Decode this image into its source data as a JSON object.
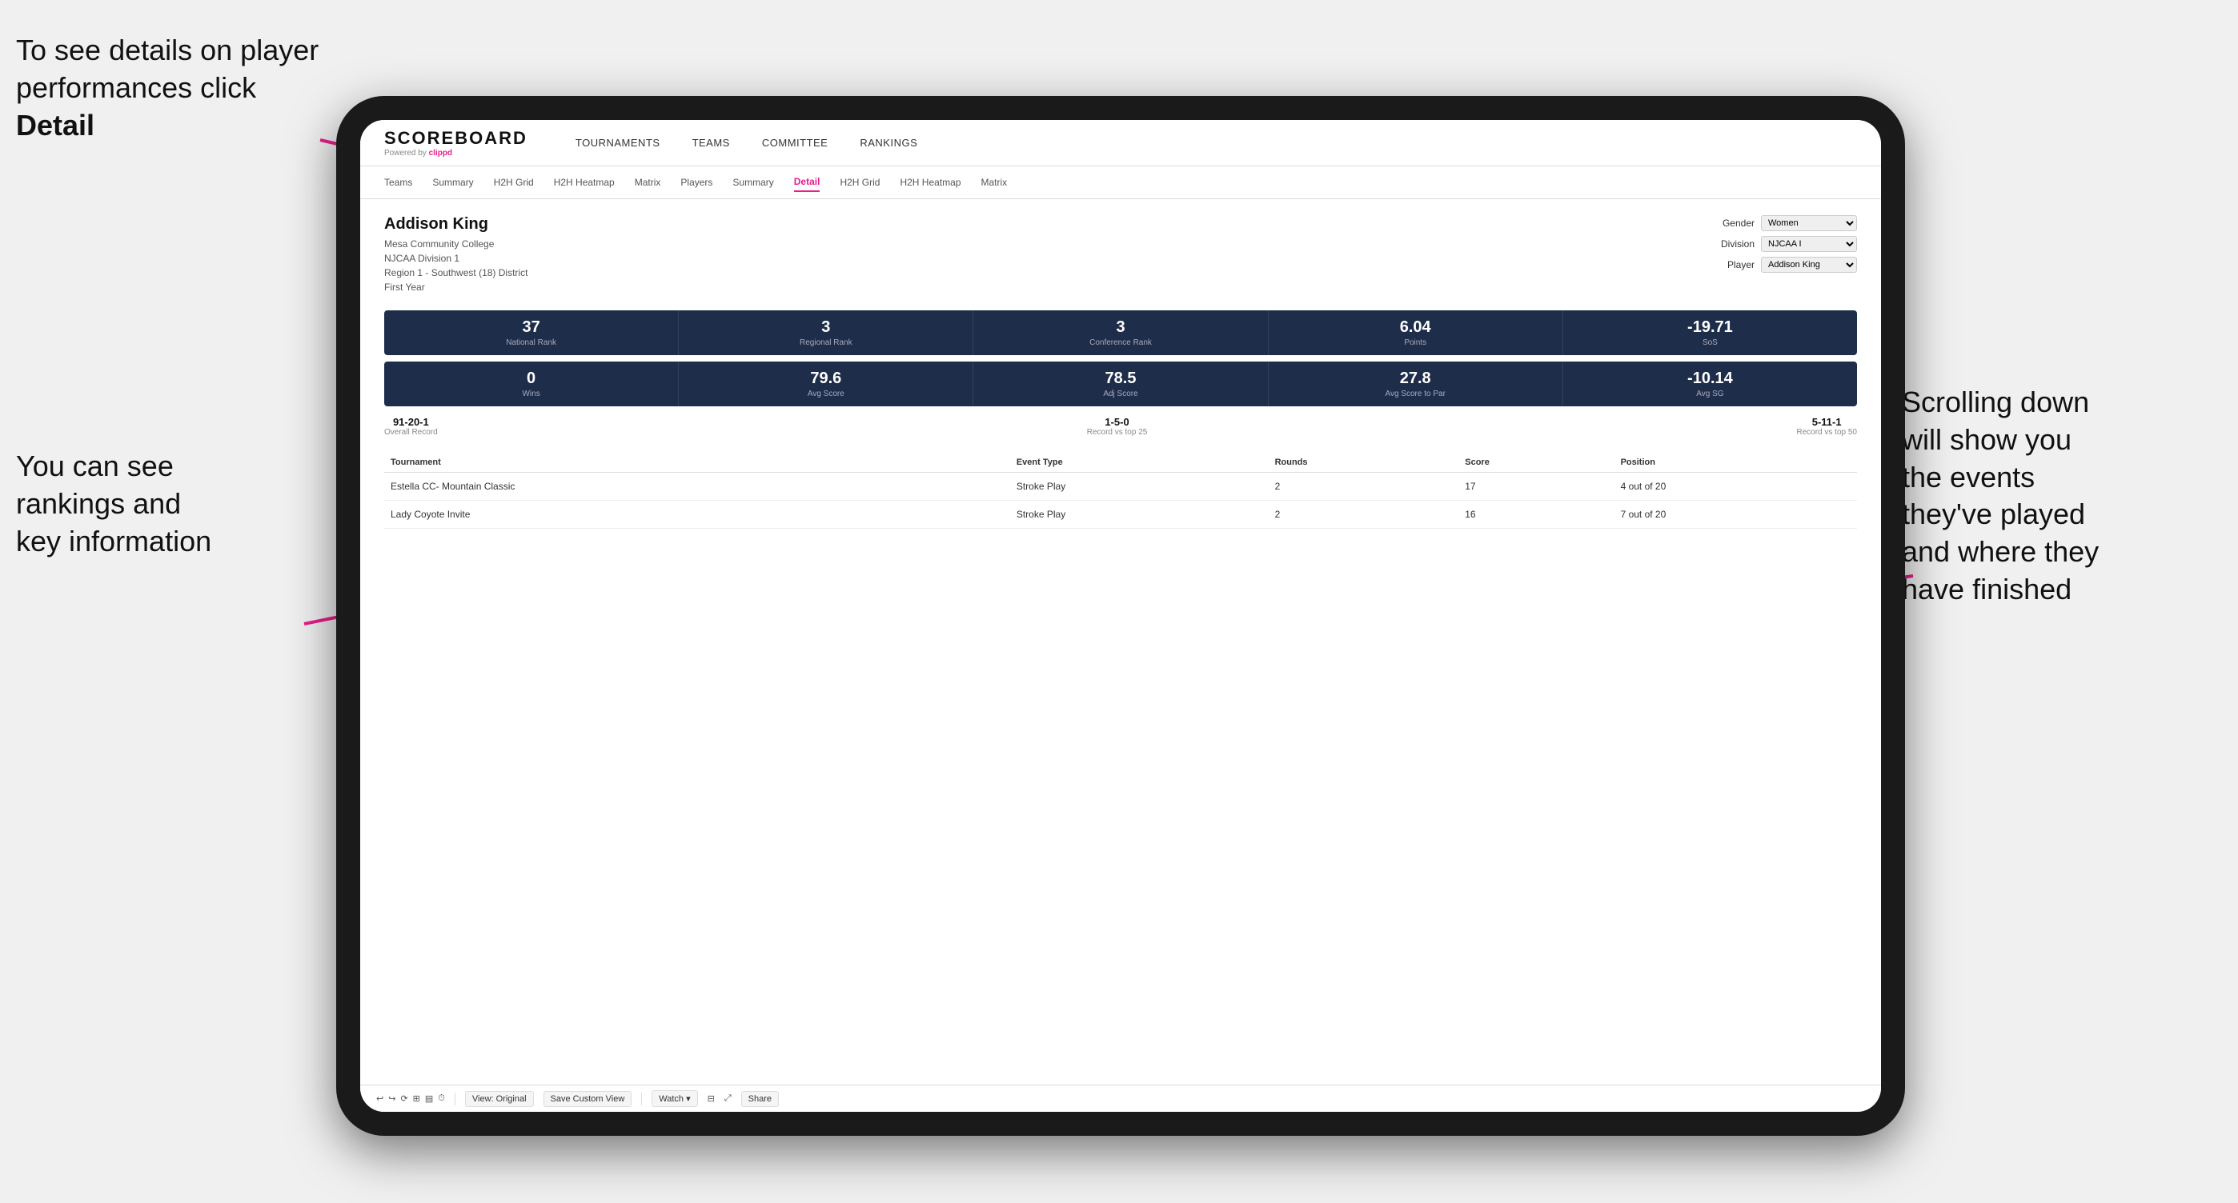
{
  "annotations": {
    "top_left": "To see details on player performances click ",
    "top_left_bold": "Detail",
    "bottom_left_line1": "You can see",
    "bottom_left_line2": "rankings and",
    "bottom_left_line3": "key information",
    "right_line1": "Scrolling down",
    "right_line2": "will show you",
    "right_line3": "the events",
    "right_line4": "they've played",
    "right_line5": "and where they",
    "right_line6": "have finished"
  },
  "top_nav": {
    "logo": "SCOREBOARD",
    "powered_by": "Powered by",
    "clippd": "clippd",
    "items": [
      "TOURNAMENTS",
      "TEAMS",
      "COMMITTEE",
      "RANKINGS"
    ]
  },
  "sub_nav": {
    "items": [
      "Teams",
      "Summary",
      "H2H Grid",
      "H2H Heatmap",
      "Matrix",
      "Players",
      "Summary",
      "Detail",
      "H2H Grid",
      "H2H Heatmap",
      "Matrix"
    ],
    "active": "Detail"
  },
  "player": {
    "name": "Addison King",
    "school": "Mesa Community College",
    "division": "NJCAA Division 1",
    "region": "Region 1 - Southwest (18) District",
    "year": "First Year"
  },
  "filters": {
    "gender_label": "Gender",
    "gender_value": "Women",
    "division_label": "Division",
    "division_value": "NJCAA I",
    "player_label": "Player",
    "player_value": "Addison King"
  },
  "stats_row1": [
    {
      "value": "37",
      "label": "National Rank"
    },
    {
      "value": "3",
      "label": "Regional Rank"
    },
    {
      "value": "3",
      "label": "Conference Rank"
    },
    {
      "value": "6.04",
      "label": "Points"
    },
    {
      "value": "-19.71",
      "label": "SoS"
    }
  ],
  "stats_row2": [
    {
      "value": "0",
      "label": "Wins"
    },
    {
      "value": "79.6",
      "label": "Avg Score"
    },
    {
      "value": "78.5",
      "label": "Adj Score"
    },
    {
      "value": "27.8",
      "label": "Avg Score to Par"
    },
    {
      "value": "-10.14",
      "label": "Avg SG"
    }
  ],
  "records": [
    {
      "value": "91-20-1",
      "label": "Overall Record"
    },
    {
      "value": "1-5-0",
      "label": "Record vs top 25"
    },
    {
      "value": "5-11-1",
      "label": "Record vs top 50"
    }
  ],
  "table": {
    "headers": [
      "Tournament",
      "",
      "Event Type",
      "Rounds",
      "Score",
      "Position"
    ],
    "rows": [
      {
        "tournament": "Estella CC- Mountain Classic",
        "event_type": "Stroke Play",
        "rounds": "2",
        "score": "17",
        "position": "4 out of 20"
      },
      {
        "tournament": "Lady Coyote Invite",
        "event_type": "Stroke Play",
        "rounds": "2",
        "score": "16",
        "position": "7 out of 20"
      }
    ]
  },
  "toolbar": {
    "buttons": [
      "View: Original",
      "Save Custom View",
      "Watch ▾",
      "Share"
    ]
  }
}
